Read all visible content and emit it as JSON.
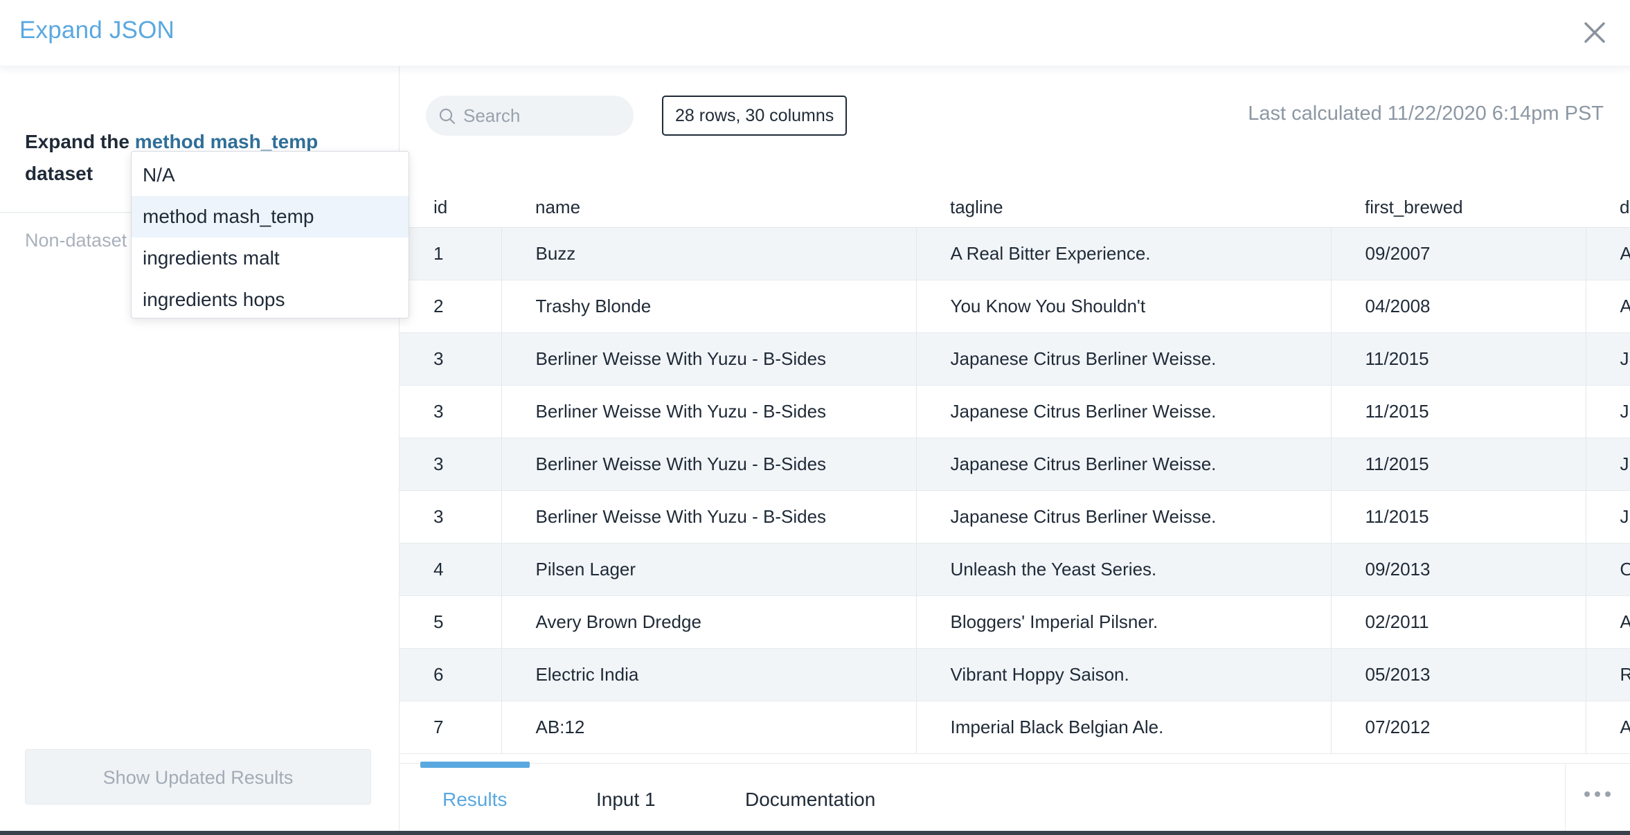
{
  "header": {
    "title": "Expand JSON",
    "close_icon": "close-icon"
  },
  "left_panel": {
    "expand_prefix": "Expand the",
    "selected_dataset": "method mash_temp",
    "expand_suffix": "dataset",
    "non_dataset_label": "Non-dataset",
    "show_button": "Show Updated Results"
  },
  "dropdown": {
    "options": [
      "N/A",
      "method mash_temp",
      "ingredients malt",
      "ingredients hops"
    ],
    "selected_index": 1
  },
  "toolbar": {
    "search_placeholder": "Search",
    "rows_badge": "28 rows, 30 columns",
    "last_calculated": "Last calculated 11/22/2020 6:14pm PST"
  },
  "table": {
    "columns": [
      "id",
      "name",
      "tagline",
      "first_brewed",
      "d"
    ],
    "rows": [
      [
        "1",
        "Buzz",
        "A Real Bitter Experience.",
        "09/2007",
        "A"
      ],
      [
        "2",
        "Trashy Blonde",
        "You Know You Shouldn't",
        "04/2008",
        "A"
      ],
      [
        "3",
        "Berliner Weisse With Yuzu - B-Sides",
        "Japanese Citrus Berliner Weisse.",
        "11/2015",
        "J"
      ],
      [
        "3",
        "Berliner Weisse With Yuzu - B-Sides",
        "Japanese Citrus Berliner Weisse.",
        "11/2015",
        "J"
      ],
      [
        "3",
        "Berliner Weisse With Yuzu - B-Sides",
        "Japanese Citrus Berliner Weisse.",
        "11/2015",
        "J"
      ],
      [
        "3",
        "Berliner Weisse With Yuzu - B-Sides",
        "Japanese Citrus Berliner Weisse.",
        "11/2015",
        "J"
      ],
      [
        "4",
        "Pilsen Lager",
        "Unleash the Yeast Series.",
        "09/2013",
        "O"
      ],
      [
        "5",
        "Avery Brown Dredge",
        "Bloggers' Imperial Pilsner.",
        "02/2011",
        "A"
      ],
      [
        "6",
        "Electric India",
        "Vibrant Hoppy Saison.",
        "05/2013",
        "R"
      ],
      [
        "7",
        "AB:12",
        "Imperial Black Belgian Ale.",
        "07/2012",
        "A"
      ]
    ]
  },
  "tabs": [
    {
      "label": "Results",
      "active": true
    },
    {
      "label": "Input 1",
      "active": false
    },
    {
      "label": "Documentation",
      "active": false
    }
  ],
  "colors": {
    "accent": "#5aa8e0",
    "link": "#2f6f98",
    "text": "#1f2a37",
    "muted": "#a9b1bb"
  }
}
